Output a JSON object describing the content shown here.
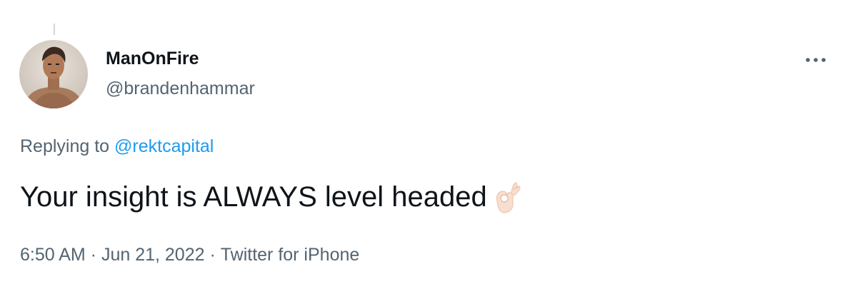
{
  "author": {
    "display_name": "ManOnFire",
    "handle": "@brandenhammar",
    "avatar_icon": "profile-photo"
  },
  "reply": {
    "prefix": "Replying to",
    "mention": "@rektcapital"
  },
  "tweet": {
    "text": "Your insight is ALWAYS level headed",
    "emoji": "ok-hand-light-skin-tone-icon"
  },
  "meta": {
    "time": "6:50 AM",
    "separator1": " · ",
    "date": "Jun 21, 2022",
    "separator2": " · ",
    "source": "Twitter for iPhone"
  },
  "colors": {
    "text_primary": "#0f1419",
    "text_secondary": "#536471",
    "link": "#1d9bf0",
    "thread_line": "#cfd9de"
  }
}
